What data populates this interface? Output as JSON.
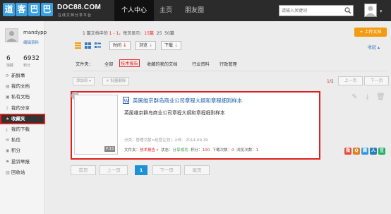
{
  "header": {
    "logo_chars": [
      "道",
      "客",
      "巴",
      "巴"
    ],
    "site_name": "DOC88.COM",
    "slogan": "在线文档分享平台",
    "nav": [
      {
        "label": "个人中心",
        "active": true
      },
      {
        "label": "主页",
        "active": false
      },
      {
        "label": "朋友圈",
        "active": false
      }
    ],
    "search_placeholder": "请输入关键词"
  },
  "profile": {
    "username": "mandypp",
    "edit_link": "编辑资料",
    "stats": [
      {
        "value": "6",
        "label": "馆藏"
      },
      {
        "value": "6932",
        "label": "积分"
      }
    ]
  },
  "sidebar": {
    "items": [
      {
        "label": "新鲜事",
        "icon": "refresh-icon"
      },
      {
        "label": "我的文档",
        "icon": "document-icon"
      },
      {
        "label": "私有文档",
        "icon": "lock-icon"
      },
      {
        "label": "我的分享",
        "icon": "share-icon"
      },
      {
        "label": "收藏夹",
        "icon": "star-icon",
        "active": true
      },
      {
        "label": "我的下载",
        "icon": "download-icon"
      },
      {
        "label": "私信",
        "icon": "message-icon"
      },
      {
        "label": "积分",
        "icon": "coin-icon"
      },
      {
        "label": "投诉举报",
        "icon": "report-icon"
      },
      {
        "label": "回收站",
        "icon": "trash-icon"
      }
    ]
  },
  "main": {
    "count_line": {
      "prefix": "1 篇文档中的",
      "range": "1 - 1",
      "middle": "，每页显示：",
      "opt15": "15篇",
      "opt25": "25",
      "opt50": "50篇"
    },
    "upload_button": "+ 上传文档",
    "sort_buttons": [
      "时间",
      "浏览",
      "下载"
    ],
    "collapse": "收起",
    "filter": {
      "label": "文件夹：",
      "items": [
        "全部",
        "技术报告",
        "收藏的我的文档",
        "行业资料",
        "行政管理"
      ],
      "active_index": 1
    },
    "actions": {
      "add_to": "添加到",
      "bulk_delete": "批量删除"
    },
    "page_info": {
      "current": "1",
      "total": "/1",
      "prev": "上一页",
      "next": "下一页"
    },
    "document": {
      "title": "英属维京群岛商业公司章程大纲和章程细则样本",
      "description": "英属维京群岛商业公司章程大纲和章程细则样本",
      "meta": "分类：管理文献>经营企划 | 上传：2014-09-30",
      "pages": "P.33",
      "folder_label": "文件夹：",
      "folder": "技术报告",
      "status_label": "状态：",
      "status": "分享成功",
      "points_label": "积分：",
      "points": "100",
      "downloads_label": "下载次数：",
      "downloads": "0",
      "views_label": "浏览次数：",
      "views": "1"
    },
    "pagination": [
      "首页",
      "上一页",
      "1",
      "下一页",
      "尾页"
    ]
  }
}
